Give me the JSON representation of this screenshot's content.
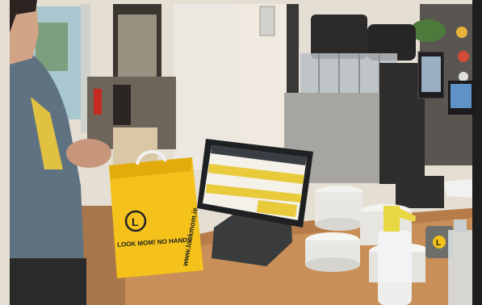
{
  "scene": {
    "description_colors": {
      "bag": "#f4c21a",
      "counter": "#c98f58",
      "pos_screen": "#e8ca3a",
      "wall": "#e7e2da",
      "shelf": "#5a5550"
    }
  },
  "bag": {
    "url_text": "www.lookmom.ie",
    "slogan_text": "LOOK MOM! NO HANDS"
  },
  "cup": {
    "logo_letter": "L"
  }
}
